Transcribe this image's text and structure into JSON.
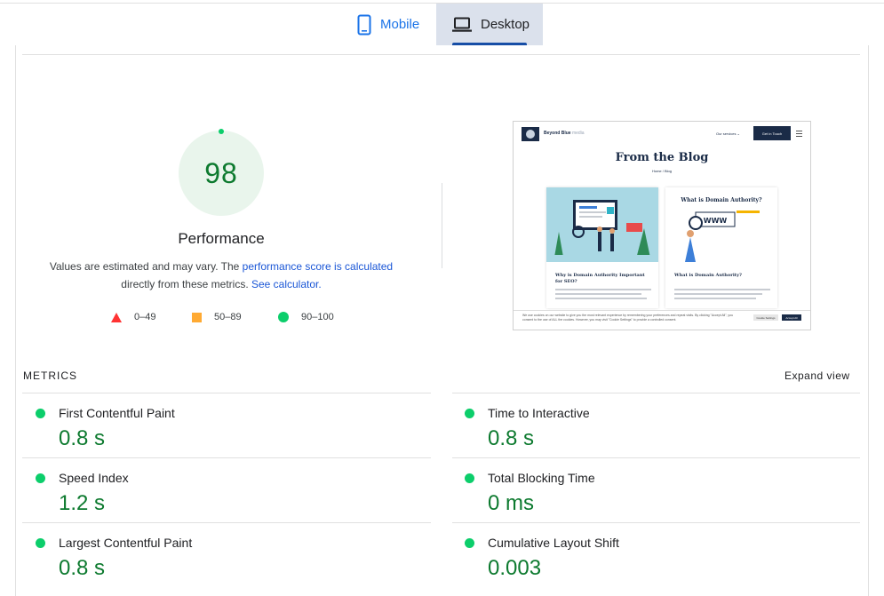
{
  "tabs": [
    {
      "label": "Mobile",
      "icon": "mobile-phone-icon",
      "selected": false
    },
    {
      "label": "Desktop",
      "icon": "laptop-icon",
      "selected": true
    }
  ],
  "score": {
    "value": "98",
    "title": "Performance",
    "desc_prefix": "Values are estimated and may vary. The ",
    "desc_link1": "performance score is calculated",
    "desc_middle": "directly from these metrics. ",
    "desc_link2": "See calculator.",
    "color": "#0cce6b"
  },
  "legend": [
    {
      "range": "0–49",
      "shape": "triangle",
      "color": "#ff3333"
    },
    {
      "range": "50–89",
      "shape": "square",
      "color": "#ffaa33"
    },
    {
      "range": "90–100",
      "shape": "circle",
      "color": "#0cce6b"
    }
  ],
  "screenshot": {
    "brand": "Beyond Blue",
    "brand_suffix": "media",
    "services": "Our services ⌄",
    "cta": "Get in Touch",
    "title": "From the Blog",
    "breadcrumb": "Home / Blog",
    "card1_title": "Why is Domain Authority Important for SEO?",
    "card2_heading": "What is Domain Authority?",
    "card2_title": "What is Domain Authority?",
    "cookie_text": "We use cookies on our website to give you the most relevant experience by remembering your preferences and repeat visits. By clicking \"Accept All\", you consent to the use of ALL the cookies. However, you may visit \"Cookie Settings\" to provide a controlled consent.",
    "cookie_settings": "Cookie Settings",
    "cookie_accept": "Accept All"
  },
  "metrics": {
    "label": "METRICS",
    "expand": "Expand view",
    "items": [
      {
        "name": "First Contentful Paint",
        "value": "0.8 s"
      },
      {
        "name": "Time to Interactive",
        "value": "0.8 s"
      },
      {
        "name": "Speed Index",
        "value": "1.2 s"
      },
      {
        "name": "Total Blocking Time",
        "value": "0 ms"
      },
      {
        "name": "Largest Contentful Paint",
        "value": "0.8 s"
      },
      {
        "name": "Cumulative Layout Shift",
        "value": "0.003"
      }
    ]
  }
}
